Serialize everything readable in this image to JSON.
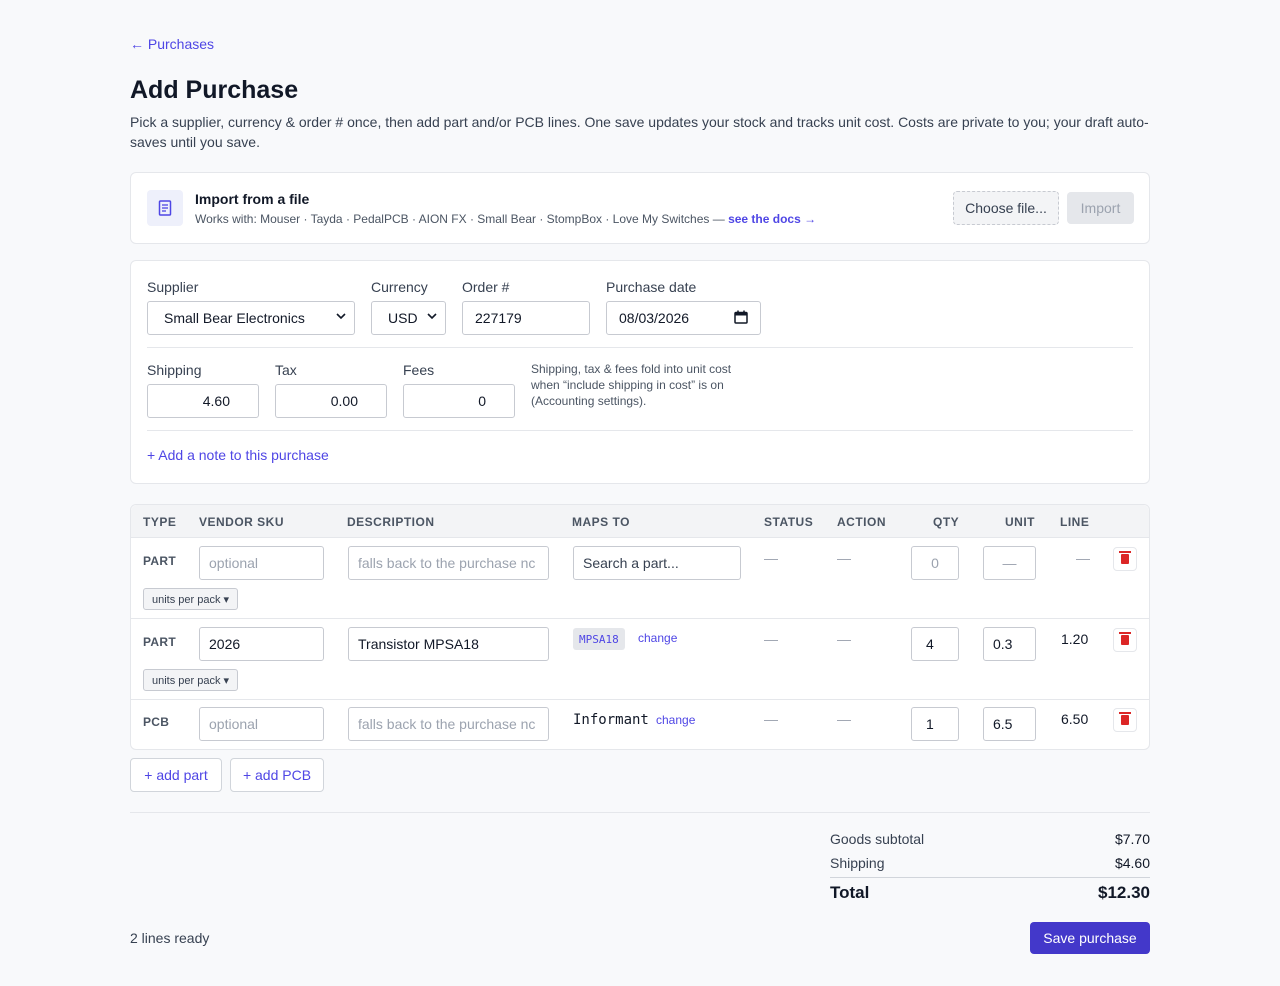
{
  "nav": {
    "back_label": "← Purchases"
  },
  "page": {
    "title": "Add Purchase",
    "intro": "Pick a supplier, currency & order # once, then add part and/or PCB lines. One save updates your stock and tracks unit cost. Costs are private to you; your draft auto-saves until you save."
  },
  "import": {
    "title": "Import from a file",
    "subtitle": "Works with: Mouser · Tayda · PedalPCB · AION FX · Small Bear · StompBox · Love My Switches — ",
    "docs_link": "see the docs →",
    "choose_label": "Choose file...",
    "import_label": "Import",
    "icon": "file-icon"
  },
  "form": {
    "supplier_label": "Supplier",
    "supplier_value": "Small Bear Electronics",
    "currency_label": "Currency",
    "currency_value": "USD",
    "order_label": "Order #",
    "order_value": "227179",
    "date_label": "Purchase date",
    "date_value": "08/03/2026",
    "shipping_label": "Shipping",
    "shipping_value": "4.60",
    "tax_label": "Tax",
    "tax_value": "0.00",
    "fees_label": "Fees",
    "fees_value": "0",
    "fold_note": "Shipping, tax & fees fold into unit cost when “include shipping in cost” is on (Accounting settings).",
    "add_note_label": "+ Add a note to this purchase"
  },
  "table": {
    "headers": {
      "type": "TYPE",
      "vendor_sku": "VENDOR SKU",
      "description": "DESCRIPTION",
      "maps_to": "MAPS TO",
      "status": "STATUS",
      "action": "ACTION",
      "qty": "QTY",
      "unit": "UNIT",
      "line": "LINE"
    },
    "rows": [
      {
        "type": "PART",
        "sku_placeholder": "optional",
        "desc_placeholder": "falls back to the purchase nc",
        "maps_placeholder": "Search a part...",
        "status": "—",
        "action": "—",
        "qty_placeholder": "0",
        "unit_placeholder": "—",
        "line": "—",
        "units_per_pack": "units per pack ▾"
      },
      {
        "type": "PART",
        "sku": "2026",
        "desc": "Transistor MPSA18",
        "maps_chip": "MPSA18",
        "change": "change",
        "status": "—",
        "action": "—",
        "qty": "4",
        "unit": "0.3",
        "line": "1.20",
        "units_per_pack": "units per pack ▾"
      },
      {
        "type": "PCB",
        "sku_placeholder": "optional",
        "desc_placeholder": "falls back to the purchase nc",
        "maps_text": "Informant",
        "change": "change",
        "status": "—",
        "action": "—",
        "qty": "1",
        "unit": "6.5",
        "line": "6.50"
      }
    ],
    "add_part_label": "+ add part",
    "add_pcb_label": "+ add PCB"
  },
  "summary": {
    "goods_label": "Goods subtotal",
    "goods_value": "$7.70",
    "shipping_label": "Shipping",
    "shipping_value": "$4.60",
    "total_label": "Total",
    "total_value": "$12.30"
  },
  "footer": {
    "ready_text": "2 lines ready",
    "save_label": "Save purchase"
  },
  "colors": {
    "accent": "#4f46e5",
    "primary_button": "#4338ca",
    "danger": "#dc2626"
  }
}
